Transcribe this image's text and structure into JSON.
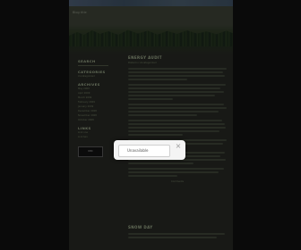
{
  "header": {
    "blog_title": "Blog title"
  },
  "sidebar": {
    "search_heading": "SEARCH",
    "categories_heading": "CATEGORIES",
    "categories": [
      "Uncategorized"
    ],
    "archives_heading": "ARCHIVES",
    "archives": [
      "May 2009",
      "April 2009",
      "March 2009",
      "February 2009",
      "January 2009",
      "December 2008",
      "November 2008",
      "October 2008"
    ],
    "links_heading": "LINKS",
    "links": [
      "Link one",
      "Link two"
    ],
    "badge_text": "W3C"
  },
  "post1": {
    "title": "ENERGY AUDIT",
    "meta": "Posted in Uncategorized",
    "footer": "Comments"
  },
  "post2": {
    "title": "SNOW DAY"
  },
  "dialog": {
    "message": "Unavailable",
    "close_label": "×"
  },
  "colors": {
    "accent": "#9aa88a",
    "background": "#262722",
    "overlay": "#000000"
  }
}
